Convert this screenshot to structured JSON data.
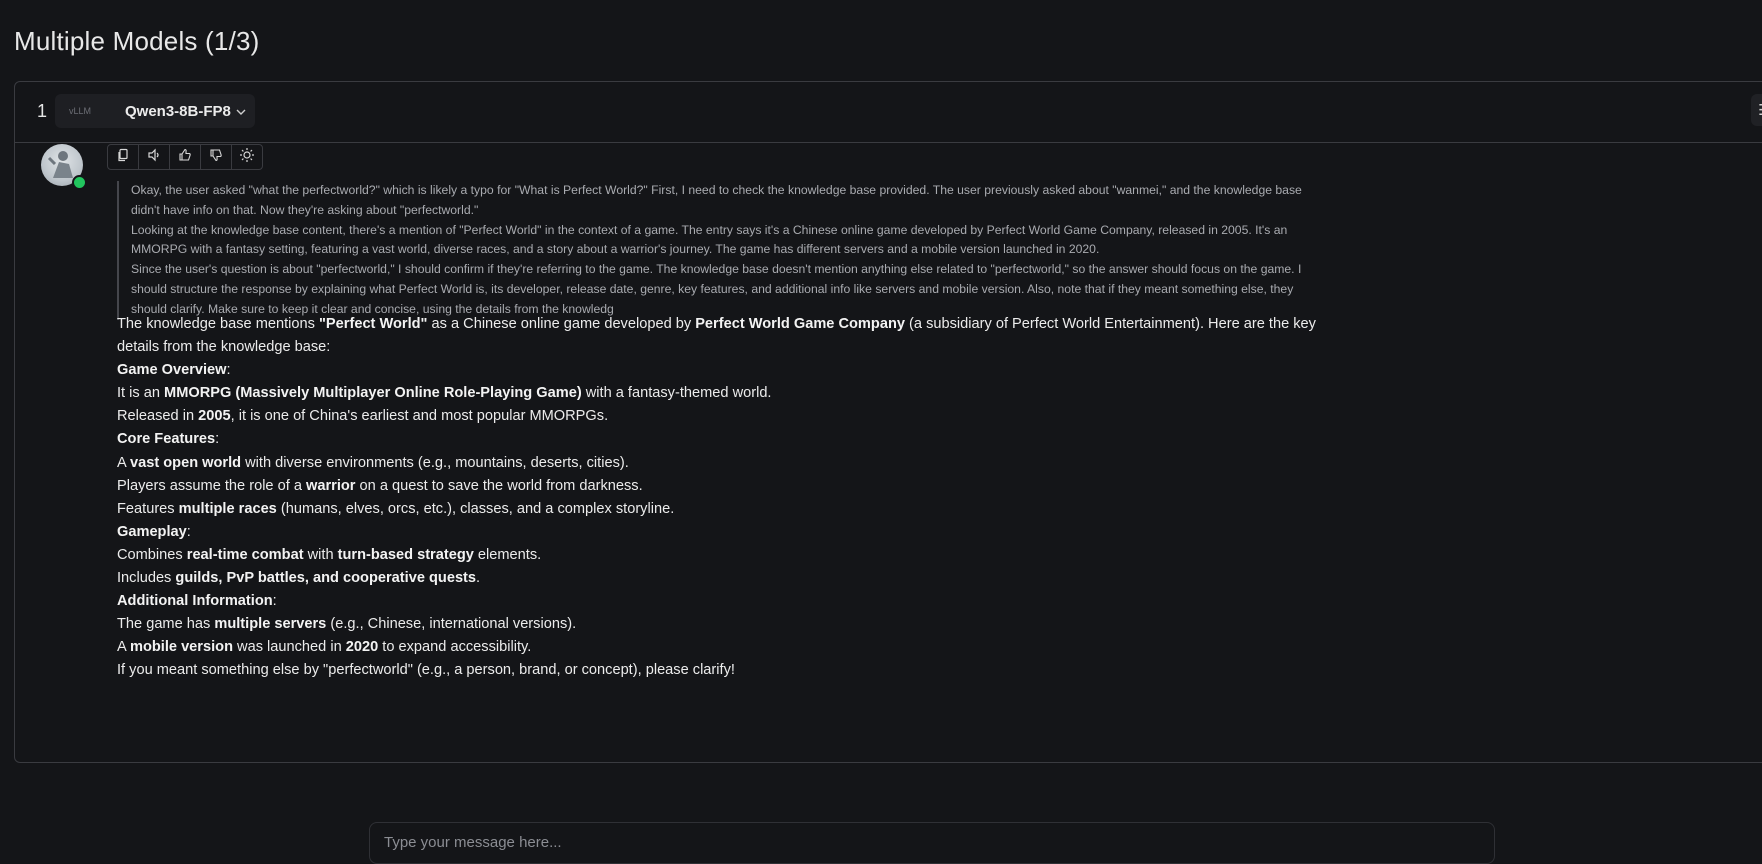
{
  "page": {
    "title": "Multiple Models (1/3)"
  },
  "panel": {
    "index": "1",
    "model_logo_text": "vLLM",
    "model_name": "Qwen3-8B-FP8"
  },
  "toolbar": {
    "icons": [
      "copy-icon",
      "speaker-icon",
      "thumbs-up-icon",
      "thumbs-down-icon",
      "lightbulb-icon"
    ]
  },
  "reasoning": [
    "Okay, the user asked \"what the perfectworld?\" which is likely a typo for \"What is Perfect World?\" First, I need to check the knowledge base provided. The user previously asked about \"wanmei,\" and the knowledge base didn't have info on that. Now they're asking about \"perfectworld.\"",
    "Looking at the knowledge base content, there's a mention of \"Perfect World\" in the context of a game. The entry says it's a Chinese online game developed by Perfect World Game Company, released in 2005. It's an MMORPG with a fantasy setting, featuring a vast world, diverse races, and a story about a warrior's journey. The game has different servers and a mobile version launched in 2020.",
    "Since the user's question is about \"perfectworld,\" I should confirm if they're referring to the game. The knowledge base doesn't mention anything else related to \"perfectworld,\" so the answer should focus on the game. I should structure the response by explaining what Perfect World is, its developer, release date, genre, key features, and additional info like servers and mobile version. Also, note that if they meant something else, they should clarify. Make sure to keep it clear and concise, using the details from the knowledg"
  ],
  "answer": {
    "intro": [
      "The knowledge base mentions ",
      "\"Perfect World\"",
      " as a Chinese online game developed by ",
      "Perfect World Game Company",
      " (a subsidiary of Perfect World Entertainment). Here are the key details from the knowledge base:"
    ],
    "h_overview": "Game Overview",
    "ov1": [
      "It is an ",
      "MMORPG (Massively Multiplayer Online Role-Playing Game)",
      " with a fantasy-themed world."
    ],
    "ov2": [
      "Released in ",
      "2005",
      ", it is one of China's earliest and most popular MMORPGs."
    ],
    "h_core": "Core Features",
    "cf1": [
      "A ",
      "vast open world",
      " with diverse environments (e.g., mountains, deserts, cities)."
    ],
    "cf2": [
      "Players assume the role of a ",
      "warrior",
      " on a quest to save the world from darkness."
    ],
    "cf3": [
      "Features ",
      "multiple races",
      " (humans, elves, orcs, etc.), classes, and a complex storyline."
    ],
    "h_gameplay": "Gameplay",
    "gp1": [
      "Combines ",
      "real-time combat",
      " with ",
      "turn-based strategy",
      " elements."
    ],
    "gp2": [
      "Includes ",
      "guilds, PvP battles, and cooperative quests",
      "."
    ],
    "h_additional": "Additional Information",
    "ai1": [
      "The game has ",
      "multiple servers",
      " (e.g., Chinese, international versions)."
    ],
    "ai2": [
      "A ",
      "mobile version",
      " was launched in ",
      "2020",
      " to expand accessibility."
    ],
    "closing": "If you meant something else by \"perfectworld\" (e.g., a person, brand, or concept), please clarify!",
    "colon": ":"
  },
  "composer": {
    "placeholder": "Type your message here..."
  }
}
